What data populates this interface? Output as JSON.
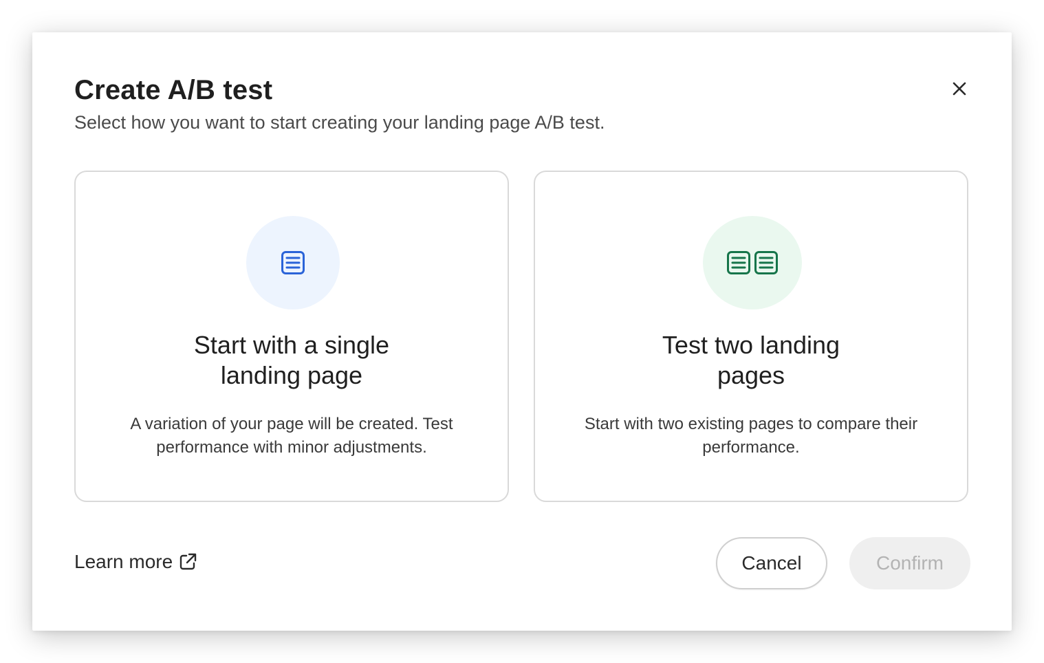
{
  "dialog": {
    "title": "Create A/B test",
    "subtitle": "Select how you want to start creating your landing page A/B test."
  },
  "options": [
    {
      "title": "Start with a single landing page",
      "description": "A variation of your page will be created. Test performance with minor adjustments.",
      "icon": "single-page-icon",
      "accent": "#2a63d8",
      "icon_bg": "#edf4fe"
    },
    {
      "title": "Test two landing pages",
      "description": "Start with two existing pages to compare their performance.",
      "icon": "two-pages-icon",
      "accent": "#16754a",
      "icon_bg": "#eaf8ef"
    }
  ],
  "footer": {
    "learn_more": "Learn more",
    "cancel": "Cancel",
    "confirm": "Confirm",
    "confirm_disabled": true
  }
}
